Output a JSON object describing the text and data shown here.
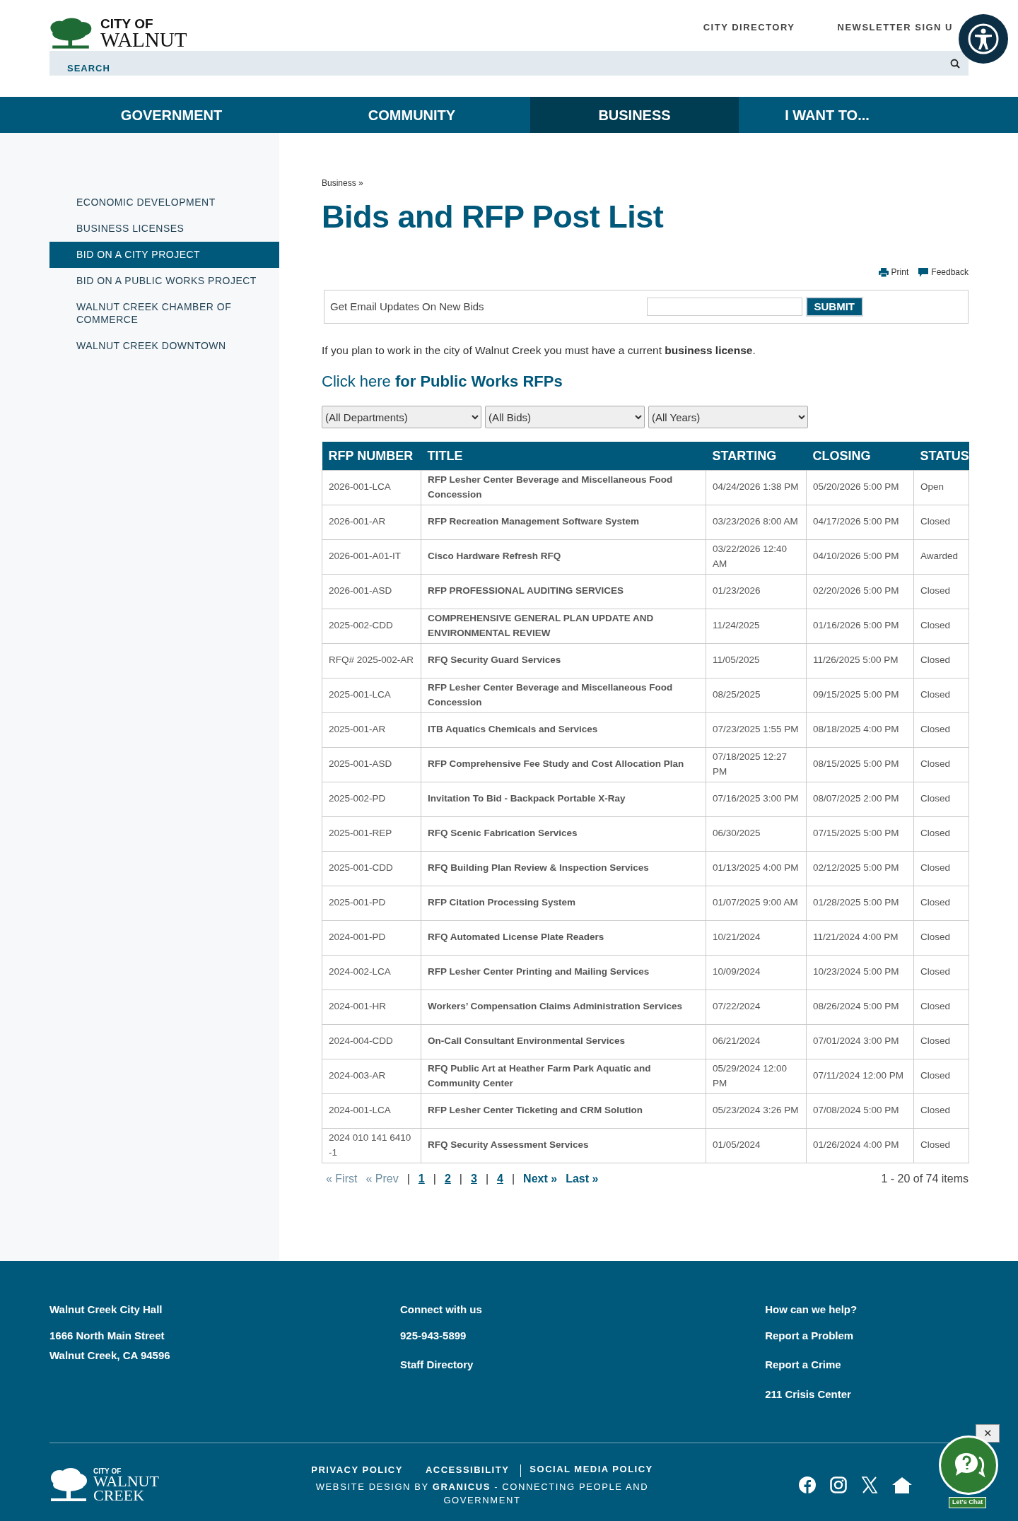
{
  "header": {
    "logo": {
      "line1": "CITY OF",
      "line2": "WALNUT"
    },
    "top_links": [
      "CITY DIRECTORY",
      "NEWSLETTER SIGN U"
    ],
    "search": {
      "label": "SEARCH"
    }
  },
  "nav": [
    {
      "label": "GOVERNMENT",
      "selected": false
    },
    {
      "label": "COMMUNITY",
      "selected": false
    },
    {
      "label": "BUSINESS",
      "selected": true
    },
    {
      "label": "I WANT TO...",
      "selected": false
    }
  ],
  "sidebar": [
    {
      "label": "ECONOMIC DEVELOPMENT",
      "selected": false
    },
    {
      "label": "BUSINESS LICENSES",
      "selected": false
    },
    {
      "label": "BID ON A CITY PROJECT",
      "selected": true
    },
    {
      "label": "BID ON A PUBLIC WORKS PROJECT",
      "selected": false
    },
    {
      "label": "WALNUT CREEK CHAMBER OF COMMERCE",
      "selected": false
    },
    {
      "label": "WALNUT CREEK DOWNTOWN",
      "selected": false
    }
  ],
  "breadcrumb": {
    "link": "Business",
    "separator": "»"
  },
  "title": "Bids and RFP Post List",
  "tools": [
    {
      "label": "Print",
      "kind": "print"
    },
    {
      "label": "Feedback",
      "kind": "feedback"
    }
  ],
  "email_form": {
    "label": "Get Email Updates On New Bids",
    "button": "SUBMIT"
  },
  "notice": {
    "before": "If you plan to work in the city of Walnut Creek you must have a current",
    "link": "business license",
    "after": "."
  },
  "public_works": {
    "link": "Click here",
    "rest": "for Public Works RFPs"
  },
  "filters": [
    "(All Departments)",
    "(All Bids)",
    "(All Years)"
  ],
  "table": {
    "columns": [
      "RFP NUMBER",
      "TITLE",
      "STARTING",
      "CLOSING",
      "STATUS"
    ],
    "rows": [
      {
        "rfp_number": "2026-001-LCA",
        "title": "RFP Lesher Center Beverage and Miscellaneous Food Concession",
        "starting": "04/24/2026 1:38 PM",
        "closing": "05/20/2026 5:00 PM",
        "status": "Open"
      },
      {
        "rfp_number": "2026-001-AR",
        "title": "RFP Recreation Management Software System",
        "starting": "03/23/2026 8:00 AM",
        "closing": "04/17/2026 5:00 PM",
        "status": "Closed"
      },
      {
        "rfp_number": "2026-001-A01-IT",
        "title": "Cisco Hardware Refresh RFQ",
        "starting": "03/22/2026 12:40 AM",
        "closing": "04/10/2026 5:00 PM",
        "status": "Awarded"
      },
      {
        "rfp_number": "2026-001-ASD",
        "title": "RFP PROFESSIONAL AUDITING SERVICES",
        "starting": "01/23/2026",
        "closing": "02/20/2026 5:00 PM",
        "status": "Closed"
      },
      {
        "rfp_number": "2025-002-CDD",
        "title": "COMPREHENSIVE GENERAL PLAN UPDATE AND ENVIRONMENTAL REVIEW",
        "starting": "11/24/2025",
        "closing": "01/16/2026 5:00 PM",
        "status": "Closed"
      },
      {
        "rfp_number": "RFQ# 2025-002-AR",
        "title": "RFQ Security Guard Services",
        "starting": "11/05/2025",
        "closing": "11/26/2025 5:00 PM",
        "status": "Closed"
      },
      {
        "rfp_number": "2025-001-LCA",
        "title": "RFP Lesher Center Beverage and Miscellaneous Food Concession",
        "starting": "08/25/2025",
        "closing": "09/15/2025 5:00 PM",
        "status": "Closed"
      },
      {
        "rfp_number": "2025-001-AR",
        "title": "ITB Aquatics Chemicals and Services",
        "starting": "07/23/2025 1:55 PM",
        "closing": "08/18/2025 4:00 PM",
        "status": "Closed"
      },
      {
        "rfp_number": "2025-001-ASD",
        "title": "RFP Comprehensive Fee Study and Cost Allocation Plan",
        "starting": "07/18/2025 12:27 PM",
        "closing": "08/15/2025 5:00 PM",
        "status": "Closed"
      },
      {
        "rfp_number": "2025-002-PD",
        "title": "Invitation To Bid - Backpack Portable X-Ray",
        "starting": "07/16/2025 3:00 PM",
        "closing": "08/07/2025 2:00 PM",
        "status": "Closed"
      },
      {
        "rfp_number": "2025-001-REP",
        "title": "RFQ Scenic Fabrication Services",
        "starting": "06/30/2025",
        "closing": "07/15/2025 5:00 PM",
        "status": "Closed"
      },
      {
        "rfp_number": "2025-001-CDD",
        "title": "RFQ Building Plan Review & Inspection Services",
        "starting": "01/13/2025 4:00 PM",
        "closing": "02/12/2025 5:00 PM",
        "status": "Closed"
      },
      {
        "rfp_number": "2025-001-PD",
        "title": "RFP Citation Processing System",
        "starting": "01/07/2025 9:00 AM",
        "closing": "01/28/2025 5:00 PM",
        "status": "Closed"
      },
      {
        "rfp_number": "2024-001-PD",
        "title": "RFQ Automated License Plate Readers",
        "starting": "10/21/2024",
        "closing": "11/21/2024 4:00 PM",
        "status": "Closed"
      },
      {
        "rfp_number": "2024-002-LCA",
        "title": "RFP Lesher Center Printing and Mailing Services",
        "starting": "10/09/2024",
        "closing": "10/23/2024 5:00 PM",
        "status": "Closed"
      },
      {
        "rfp_number": "2024-001-HR",
        "title": "Workers’ Compensation Claims Administration Services",
        "starting": "07/22/2024",
        "closing": "08/26/2024 5:00 PM",
        "status": "Closed"
      },
      {
        "rfp_number": "2024-004-CDD",
        "title": "On-Call Consultant Environmental Services",
        "starting": "06/21/2024",
        "closing": "07/01/2024 3:00 PM",
        "status": "Closed"
      },
      {
        "rfp_number": "2024-003-AR",
        "title": "RFQ Public Art at Heather Farm Park Aquatic and Community Center",
        "starting": "05/29/2024 12:00 PM",
        "closing": "07/11/2024 12:00 PM",
        "status": "Closed"
      },
      {
        "rfp_number": "2024-001-LCA",
        "title": "RFP Lesher Center Ticketing and CRM Solution",
        "starting": "05/23/2024 3:26 PM",
        "closing": "07/08/2024 5:00 PM",
        "status": "Closed"
      },
      {
        "rfp_number": "2024 010 141 6410 -1",
        "title": "RFQ Security Assessment Services",
        "starting": "01/05/2024",
        "closing": "01/26/2024 4:00 PM",
        "status": "Closed"
      }
    ]
  },
  "pager": {
    "items": [
      {
        "label": "« First",
        "kind": "disabled"
      },
      {
        "label": "« Prev",
        "kind": "disabled"
      },
      {
        "label": "|",
        "kind": "separator"
      },
      {
        "label": "1",
        "kind": "page"
      },
      {
        "label": "|",
        "kind": "separator"
      },
      {
        "label": "2",
        "kind": "page"
      },
      {
        "label": "|",
        "kind": "separator"
      },
      {
        "label": "3",
        "kind": "page"
      },
      {
        "label": "|",
        "kind": "separator"
      },
      {
        "label": "4",
        "kind": "page"
      },
      {
        "label": "|",
        "kind": "separator"
      },
      {
        "label": "Next »",
        "kind": "nav"
      },
      {
        "label": "Last »",
        "kind": "nav"
      }
    ],
    "summary": "1 - 20 of 74 items"
  },
  "footer": {
    "columns": [
      {
        "heading": "Walnut Creek City Hall",
        "lines": [
          {
            "text": "1666 North Main Street",
            "kind": "text"
          },
          {
            "text": "Walnut Creek, CA 94596",
            "kind": "text"
          }
        ]
      },
      {
        "heading": "Connect with us",
        "lines": [
          {
            "text": "925-943-5899",
            "kind": "link"
          },
          {
            "text": "Staff Directory",
            "kind": "link"
          }
        ]
      },
      {
        "heading": "How can we help?",
        "lines": [
          {
            "text": "Report a Problem",
            "kind": "link"
          },
          {
            "text": "Report a Crime",
            "kind": "link"
          },
          {
            "text": "211 Crisis Center",
            "kind": "link"
          }
        ]
      }
    ],
    "logo": {
      "line1": "CITY OF",
      "line2": "WALNUT",
      "line3": "CREEK"
    },
    "links": [
      "PRIVACY POLICY",
      "ACCESSIBILITY",
      "SOCIAL MEDIA POLICY"
    ],
    "credit": {
      "before": "WEBSITE DESIGN BY",
      "bold": "GRANICUS",
      "after": "- CONNECTING PEOPLE AND GOVERNMENT"
    }
  },
  "chat": {
    "label": "Let's Chat",
    "close": "✕"
  }
}
